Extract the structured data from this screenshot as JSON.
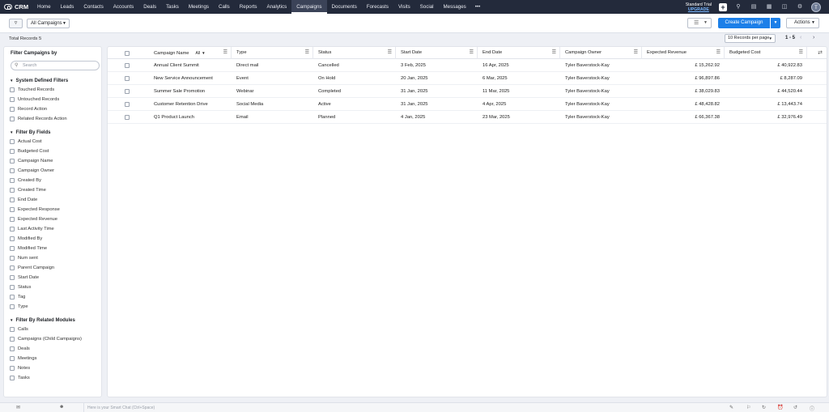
{
  "brand": {
    "name": "CRM"
  },
  "nav": {
    "items": [
      {
        "label": "Home"
      },
      {
        "label": "Leads"
      },
      {
        "label": "Contacts"
      },
      {
        "label": "Accounts"
      },
      {
        "label": "Deals"
      },
      {
        "label": "Tasks"
      },
      {
        "label": "Meetings"
      },
      {
        "label": "Calls"
      },
      {
        "label": "Reports"
      },
      {
        "label": "Analytics"
      },
      {
        "label": "Campaigns",
        "active": true
      },
      {
        "label": "Documents"
      },
      {
        "label": "Forecasts"
      },
      {
        "label": "Visits"
      },
      {
        "label": "Social"
      },
      {
        "label": "Messages"
      }
    ],
    "more": "•••",
    "trial_label": "Standard Trial",
    "upgrade_label": "UPGRADE",
    "avatar_initial": "T"
  },
  "toolbar": {
    "view_label": "All Campaigns",
    "create_label": "Create Campaign",
    "actions_label": "Actions"
  },
  "records": {
    "total_label": "Total Records 5",
    "per_page": "10 Records per page",
    "range": "1 - 5"
  },
  "sidebar": {
    "title": "Filter Campaigns by",
    "search_placeholder": "Search",
    "sections": [
      {
        "title": "System Defined Filters",
        "options": [
          "Touched Records",
          "Untouched Records",
          "Record Action",
          "Related Records Action"
        ]
      },
      {
        "title": "Filter By Fields",
        "options": [
          "Actual Cost",
          "Budgeted Cost",
          "Campaign Name",
          "Campaign Owner",
          "Created By",
          "Created Time",
          "End Date",
          "Expected Response",
          "Expected Revenue",
          "Last Activity Time",
          "Modified By",
          "Modified Time",
          "Num sent",
          "Parent Campaign",
          "Start Date",
          "Status",
          "Tag",
          "Type"
        ]
      },
      {
        "title": "Filter By Related Modules",
        "options": [
          "Calls",
          "Campaigns (Child Campaigns)",
          "Deals",
          "Meetings",
          "Notes",
          "Tasks"
        ]
      }
    ]
  },
  "table": {
    "name_filter": "All",
    "columns": [
      "Campaign Name",
      "Type",
      "Status",
      "Start Date",
      "End Date",
      "Campaign Owner",
      "Expected Revenue",
      "Budgeted Cost"
    ],
    "rows": [
      [
        "Annual Client Summit",
        "Direct mail",
        "Cancelled",
        "3 Feb, 2025",
        "16 Apr, 2025",
        "Tyler Baverstock-Kay",
        "£ 15,262.92",
        "£ 40,922.83"
      ],
      [
        "New Service Announcement",
        "Event",
        "On Hold",
        "20 Jan, 2025",
        "6 Mar, 2025",
        "Tyler Baverstock-Kay",
        "£ 96,897.86",
        "£ 8,287.09"
      ],
      [
        "Summer Sale Promotion",
        "Webinar",
        "Completed",
        "31 Jan, 2025",
        "11 Mar, 2025",
        "Tyler Baverstock-Kay",
        "£ 38,029.83",
        "£ 44,520.44"
      ],
      [
        "Customer Retention Drive",
        "Social Media",
        "Active",
        "31 Jan, 2025",
        "4 Apr, 2025",
        "Tyler Baverstock-Kay",
        "£ 48,428.82",
        "£ 13,443.74"
      ],
      [
        "Q1 Product Launch",
        "Email",
        "Planned",
        "4 Jan, 2025",
        "23 Mar, 2025",
        "Tyler Baverstock-Kay",
        "£ 66,367.38",
        "£ 32,976.49"
      ]
    ]
  },
  "bottom": {
    "chat_placeholder": "Here is your Smart Chat (Ctrl+Space)"
  }
}
